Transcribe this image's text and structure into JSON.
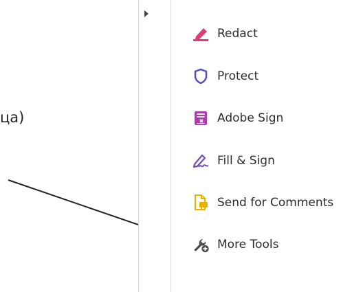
{
  "document": {
    "text_fragment": "ца)"
  },
  "tools": [
    {
      "label": "Redact",
      "icon": "redact-marker-icon",
      "color": "#e03c7a"
    },
    {
      "label": "Protect",
      "icon": "shield-icon",
      "color": "#4a4fc4"
    },
    {
      "label": "Adobe Sign",
      "icon": "adobe-sign-document-icon",
      "color": "#b03bb0"
    },
    {
      "label": "Fill & Sign",
      "icon": "fill-sign-pen-icon",
      "color": "#6f4bc2"
    },
    {
      "label": "Send for Comments",
      "icon": "send-comments-document-icon",
      "color": "#e8b400"
    },
    {
      "label": "More Tools",
      "icon": "wrench-plus-icon",
      "color": "#4a4a4a"
    }
  ]
}
